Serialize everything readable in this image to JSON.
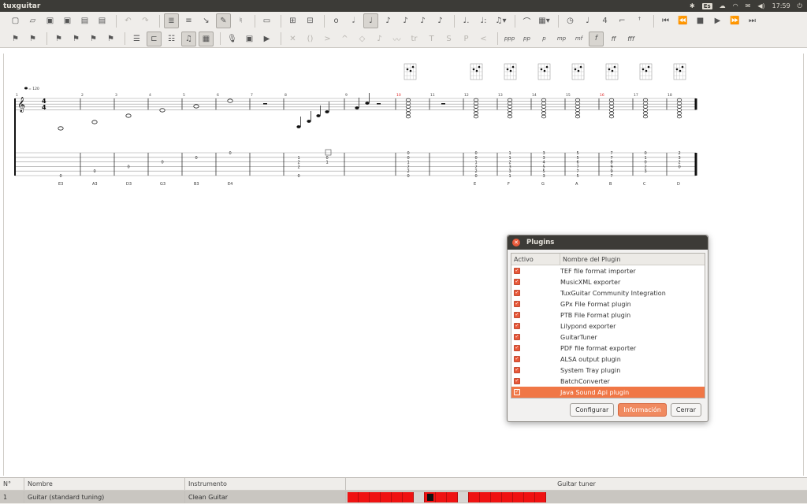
{
  "window": {
    "title": "tuxguitar"
  },
  "tray": {
    "keyboard": "Es",
    "time": "17:59"
  },
  "toolbar_row1": {
    "icons": [
      "new-file-icon",
      "open-file-icon",
      "save-icon",
      "save-as-icon",
      "print-icon",
      "print-preview-icon",
      "undo-icon",
      "redo-icon",
      "tablature-view-icon",
      "score-view-icon",
      "compact-view-icon",
      "edit-mode-icon",
      "voice-mode-icon",
      "page-layout-icon",
      "insert-measure-icon",
      "remove-measure-icon",
      "whole-note-icon",
      "half-note-icon",
      "quarter-note-icon",
      "eighth-note-icon",
      "sixteenth-note-icon",
      "thirty-second-note-icon",
      "sixty-fourth-note-icon",
      "dotted-note-icon",
      "double-dotted-icon",
      "tuplet-icon",
      "tied-note-icon",
      "chord-icon",
      "metronome-icon",
      "tempo-icon",
      "time-signature-icon",
      "repeat-open-icon",
      "repeat-close-icon",
      "first-icon",
      "previous-icon",
      "stop-icon",
      "play-icon",
      "next-icon",
      "last-icon"
    ]
  },
  "toolbar_row2": {
    "dynamics": [
      "ppp",
      "pp",
      "p",
      "mp",
      "mf",
      "f",
      "ff",
      "fff"
    ],
    "dynamics_active": "f"
  },
  "score": {
    "tempo": "= 120",
    "time_signature": {
      "top": "4",
      "bottom": "4"
    },
    "measure_numbers": [
      "1",
      "2",
      "3",
      "4",
      "5",
      "6",
      "7",
      "8",
      "9",
      "10",
      "11",
      "12",
      "13",
      "14",
      "15",
      "16",
      "17",
      "18"
    ],
    "note_names": [
      "E3",
      "A3",
      "D3",
      "G3",
      "B3",
      "E4",
      "E",
      "F",
      "G",
      "A",
      "B",
      "C",
      "D"
    ],
    "tab_columns": [
      [
        "0"
      ],
      [
        "0"
      ],
      [
        "0"
      ],
      [
        "0"
      ],
      [
        "0"
      ],
      [
        "0"
      ],
      [
        "0",
        "2",
        "2",
        "1"
      ],
      [
        "0",
        "1"
      ],
      [
        "0",
        "0",
        "1",
        "2",
        "2",
        "0"
      ],
      [
        "0",
        "0",
        "1",
        "2",
        "2",
        "0"
      ],
      [
        "1",
        "1",
        "2",
        "3",
        "3",
        "1"
      ],
      [
        "3",
        "3",
        "4",
        "5",
        "5",
        "3"
      ],
      [
        "5",
        "5",
        "6",
        "7",
        "7",
        "5"
      ],
      [
        "7",
        "7",
        "8",
        "9",
        "9",
        "7"
      ],
      [
        "0",
        "1",
        "0",
        "2",
        "3"
      ],
      [
        "2",
        "3",
        "2",
        "0"
      ]
    ]
  },
  "plugins_dialog": {
    "title": "Plugins",
    "col_active": "Activo",
    "col_name": "Nombre del Plugin",
    "items": [
      {
        "name": "TEF file format importer",
        "selected": false
      },
      {
        "name": "MusicXML exporter",
        "selected": false
      },
      {
        "name": "TuxGuitar Community Integration",
        "selected": false
      },
      {
        "name": "GPx File Format plugin",
        "selected": false
      },
      {
        "name": "PTB File Format plugin",
        "selected": false
      },
      {
        "name": "Lilypond exporter",
        "selected": false
      },
      {
        "name": "GuitarTuner",
        "selected": false
      },
      {
        "name": "PDF file format exporter",
        "selected": false
      },
      {
        "name": "ALSA output plugin",
        "selected": false
      },
      {
        "name": "System Tray plugin",
        "selected": false
      },
      {
        "name": "BatchConverter",
        "selected": false
      },
      {
        "name": "Java Sound Api plugin",
        "selected": true
      }
    ],
    "buttons": {
      "configure": "Configurar",
      "info": "Información",
      "close": "Cerrar"
    }
  },
  "tracks": {
    "headers": {
      "num": "N°",
      "name": "Nombre",
      "instrument": "Instrumento",
      "tuner": "Guitar tuner"
    },
    "rows": [
      {
        "num": "1",
        "name": "Guitar (standard tuning)",
        "instrument": "Clean Guitar"
      }
    ]
  },
  "colors": {
    "accent": "#f07746",
    "titlebar": "#3c3b37",
    "tuner_red": "#ef1212"
  }
}
